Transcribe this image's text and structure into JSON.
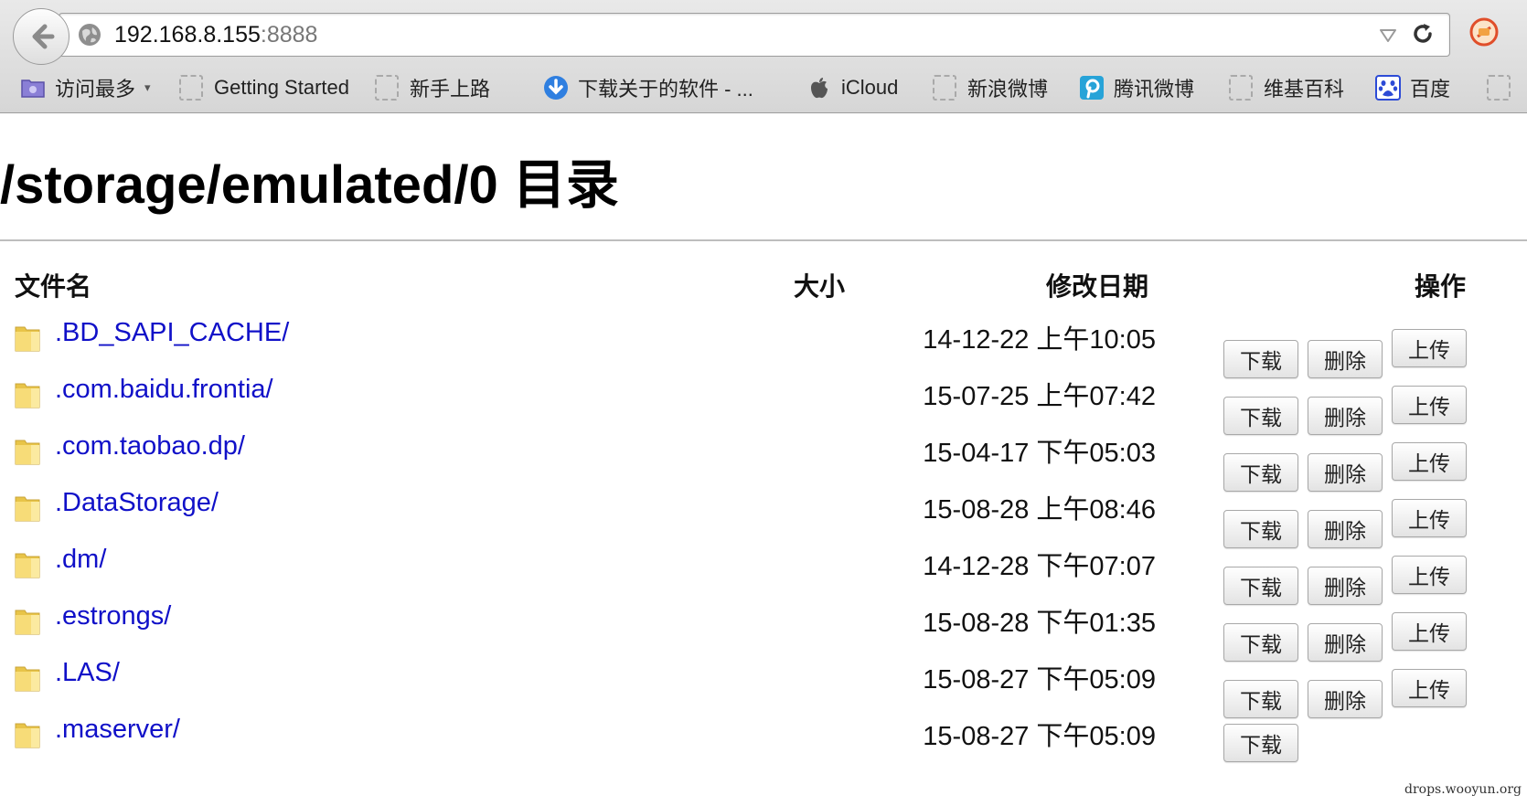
{
  "browser": {
    "url_host": "192.168.8.155",
    "url_port": ":8888",
    "bookmarks": [
      {
        "label": "访问最多",
        "icon": "most-visited-icon",
        "caret": "▾"
      },
      {
        "label": "Getting Started",
        "icon": "blank-bookmark-icon"
      },
      {
        "label": "新手上路",
        "icon": "blank-bookmark-icon"
      },
      {
        "label": "下载关于的软件 - ...",
        "icon": "download-circle-icon"
      },
      {
        "label": "iCloud",
        "icon": "apple-icon"
      },
      {
        "label": "新浪微博",
        "icon": "blank-bookmark-icon"
      },
      {
        "label": "腾讯微博",
        "icon": "tencent-weibo-icon"
      },
      {
        "label": "维基百科",
        "icon": "blank-bookmark-icon"
      },
      {
        "label": "百度",
        "icon": "baidu-paw-icon"
      }
    ]
  },
  "page": {
    "title": "/storage/emulated/0 目录",
    "columns": {
      "name": "文件名",
      "size": "大小",
      "date": "修改日期",
      "actions": "操作"
    },
    "buttons": {
      "download": "下载",
      "delete": "删除",
      "upload": "上传"
    },
    "rows": [
      {
        "name": ".BD_SAPI_CACHE/",
        "date": "14-12-22 上午10:05"
      },
      {
        "name": ".com.baidu.frontia/",
        "date": "15-07-25 上午07:42"
      },
      {
        "name": ".com.taobao.dp/",
        "date": "15-04-17 下午05:03"
      },
      {
        "name": ".DataStorage/",
        "date": "15-08-28 上午08:46"
      },
      {
        "name": ".dm/",
        "date": "14-12-28 下午07:07"
      },
      {
        "name": ".estrongs/",
        "date": "15-08-28 下午01:35"
      },
      {
        "name": ".LAS/",
        "date": "15-08-27 下午05:09"
      },
      {
        "name": ".maserver/",
        "date": "15-08-27 下午05:09"
      }
    ],
    "watermark": "drops.wooyun.org"
  },
  "colors": {
    "link": "#1010c8",
    "folder": "#f2d25a"
  }
}
